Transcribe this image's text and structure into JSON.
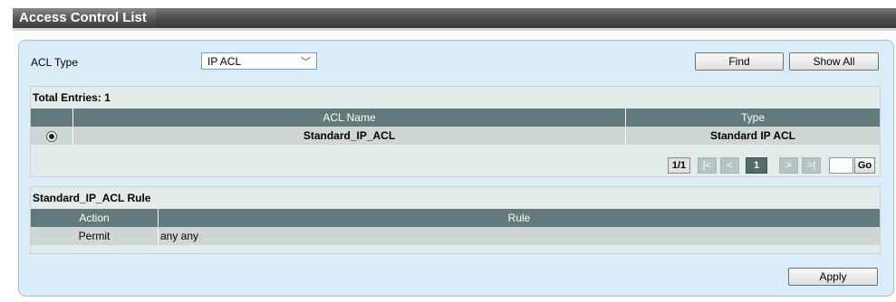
{
  "title": "Access Control List",
  "acl_type": {
    "label": "ACL Type",
    "selected": "IP ACL"
  },
  "buttons": {
    "find": "Find",
    "show_all": "Show All",
    "apply": "Apply"
  },
  "list": {
    "total_entries": "Total Entries: 1",
    "columns": [
      "ACL Name",
      "Type"
    ],
    "rows": [
      {
        "selected": true,
        "name": "Standard_IP_ACL",
        "type": "Standard IP ACL"
      }
    ]
  },
  "pager": {
    "info": "1/1",
    "first": "|<",
    "prev": "<",
    "current": "1",
    "next": ">",
    "last": ">|",
    "go": "Go",
    "page_input": ""
  },
  "rules": {
    "title": "Standard_IP_ACL Rule",
    "columns": [
      "Action",
      "Rule"
    ],
    "rows": [
      {
        "action": "Permit",
        "rule": "any any"
      }
    ]
  }
}
